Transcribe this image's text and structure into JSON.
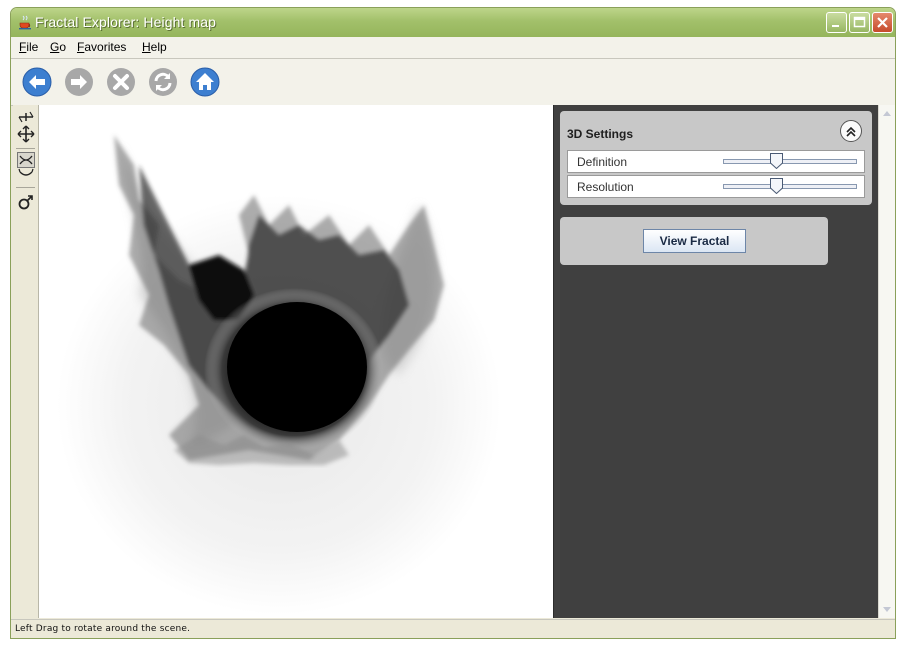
{
  "window": {
    "title": "Fractal Explorer: Height map",
    "titlebar_color": "#9cbc66"
  },
  "menu": {
    "items": [
      {
        "label": "File"
      },
      {
        "label": "Go"
      },
      {
        "label": "Favorites"
      },
      {
        "label": "Help"
      }
    ]
  },
  "toolbar": {
    "buttons": [
      {
        "icon": "back-arrow-icon",
        "enabled": true
      },
      {
        "icon": "forward-arrow-icon",
        "enabled": false
      },
      {
        "icon": "stop-icon",
        "enabled": false
      },
      {
        "icon": "refresh-icon",
        "enabled": false
      },
      {
        "icon": "home-icon",
        "enabled": true
      }
    ],
    "accent": "#3d7fd0",
    "disabled_color": "#a8a8a8"
  },
  "left_tools": {
    "icons": [
      "pan-tilt-icon",
      "move-icon",
      "rotate-scene-icon",
      "male-figure-icon"
    ]
  },
  "settings_panel": {
    "title": "3D Settings",
    "rows": [
      {
        "label": "Definition",
        "value_fraction": 0.4
      },
      {
        "label": "Resolution",
        "value_fraction": 0.4
      }
    ]
  },
  "actions": {
    "view_fractal_label": "View Fractal"
  },
  "status": {
    "text": "Left Drag to rotate around the scene."
  }
}
